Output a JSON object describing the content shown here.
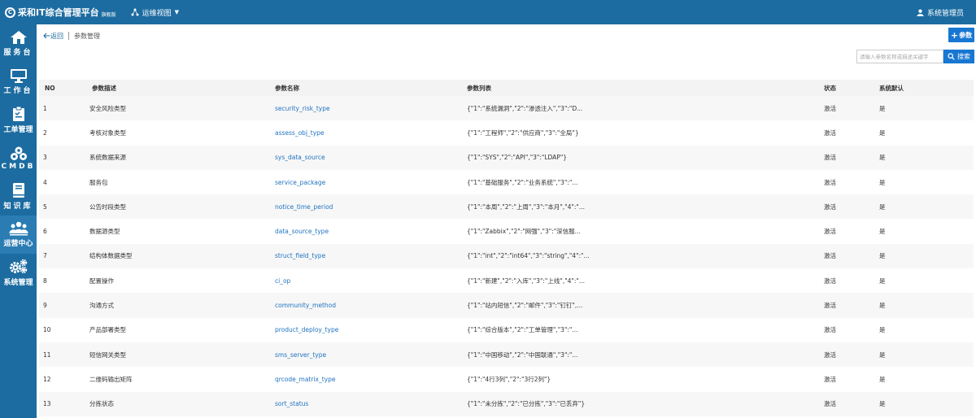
{
  "app": {
    "title": "采和IT综合管理平台",
    "subtitle": "旗舰版",
    "logo_text": "C"
  },
  "view_switch": {
    "label": "运维视图"
  },
  "user": {
    "name": "系统管理员"
  },
  "sidebar": {
    "items": [
      {
        "label": "服务台",
        "icon": "home-icon",
        "active": false
      },
      {
        "label": "工作台",
        "icon": "monitor-icon",
        "active": false
      },
      {
        "label": "工单管理",
        "icon": "clipboard-icon",
        "active": false
      },
      {
        "label": "CMDB",
        "icon": "cubes-icon",
        "active": false
      },
      {
        "label": "知识库",
        "icon": "book-icon",
        "active": false
      },
      {
        "label": "运营中心",
        "icon": "users-icon",
        "active": true
      },
      {
        "label": "系统管理",
        "icon": "gears-icon",
        "active": false
      }
    ]
  },
  "toolbar": {
    "back_label": "返回",
    "page_title": "参数管理",
    "add_label": "参数",
    "search_placeholder": "请输入参数名称或描述关键字",
    "search_label": "搜索"
  },
  "table": {
    "headers": {
      "no": "NO",
      "desc": "参数描述",
      "name": "参数名称",
      "list": "参数列表",
      "status": "状态",
      "default": "系统默认"
    },
    "rows": [
      {
        "no": "1",
        "desc": "安全风险类型",
        "name": "security_risk_type",
        "list": "{\"1\":\"系统漏洞\",\"2\":\"渗透注入\",\"3\":\"D...",
        "status": "激活",
        "default": "是"
      },
      {
        "no": "2",
        "desc": "考核对象类型",
        "name": "assess_obj_type",
        "list": "{\"1\":\"工程师\",\"2\":\"供应商\",\"3\":\"全局\"}",
        "status": "激活",
        "default": "是"
      },
      {
        "no": "3",
        "desc": "系统数据来源",
        "name": "sys_data_source",
        "list": "{\"1\":\"SYS\",\"2\":\"API\",\"3\":\"LDAP\"}",
        "status": "激活",
        "default": "是"
      },
      {
        "no": "4",
        "desc": "服务包",
        "name": "service_package",
        "list": "{\"1\":\"基础服务\",\"2\":\"业务系统\",\"3\":\"...",
        "status": "激活",
        "default": "是"
      },
      {
        "no": "5",
        "desc": "公告时段类型",
        "name": "notice_time_period",
        "list": "{\"1\":\"本周\",\"2\":\"上周\",\"3\":\"本月\",\"4\":\"...",
        "status": "激活",
        "default": "是"
      },
      {
        "no": "6",
        "desc": "数据源类型",
        "name": "data_source_type",
        "list": "{\"1\":\"Zabbix\",\"2\":\"网强\",\"3\":\"深信服...",
        "status": "激活",
        "default": "是"
      },
      {
        "no": "7",
        "desc": "结构体数据类型",
        "name": "struct_field_type",
        "list": "{\"1\":\"int\",\"2\":\"int64\",\"3\":\"string\",\"4\":\"...",
        "status": "激活",
        "default": "是"
      },
      {
        "no": "8",
        "desc": "配置操作",
        "name": "ci_op",
        "list": "{\"1\":\"新建\",\"2\":\"入库\",\"3\":\"上线\",\"4\":\"...",
        "status": "激活",
        "default": "是"
      },
      {
        "no": "9",
        "desc": "沟通方式",
        "name": "community_method",
        "list": "{\"1\":\"站内短信\",\"2\":\"邮件\",\"3\":\"钉钉\",...",
        "status": "激活",
        "default": "是"
      },
      {
        "no": "10",
        "desc": "产品部署类型",
        "name": "product_deploy_type",
        "list": "{\"1\":\"综合版本\",\"2\":\"工单管理\",\"3\":\"...",
        "status": "激活",
        "default": "是"
      },
      {
        "no": "11",
        "desc": "短信网关类型",
        "name": "sms_server_type",
        "list": "{\"1\":\"中国移动\",\"2\":\"中国联通\",\"3\":\"...",
        "status": "激活",
        "default": "是"
      },
      {
        "no": "12",
        "desc": "二维码输出矩阵",
        "name": "qrcode_matrix_type",
        "list": "{\"1\":\"4行3列\",\"2\":\"3行2列\"}",
        "status": "激活",
        "default": "是"
      },
      {
        "no": "13",
        "desc": "分拣状态",
        "name": "sort_status",
        "list": "{\"1\":\"未分拣\",\"2\":\"已分拣\",\"3\":\"已丢弃\"}",
        "status": "激活",
        "default": "是"
      }
    ]
  },
  "colors": {
    "primary": "#1c6ca1",
    "button": "#1877d2",
    "link": "#1f73c0"
  }
}
